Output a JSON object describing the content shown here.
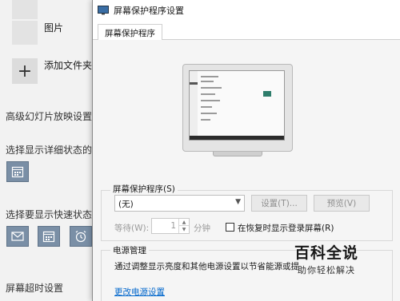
{
  "background": {
    "library_items": [
      {
        "label": "图片"
      },
      {
        "label": "添加文件夹"
      }
    ],
    "advanced_slideshow": "高级幻灯片放映设置",
    "detail_status_heading": "选择显示详细状态的应",
    "quick_status_heading": "选择要显示快速状态的",
    "screen_timeout": "屏幕超时设置",
    "add_icon": "plus-icon"
  },
  "dialog": {
    "title": "屏幕保护程序设置",
    "tab": "屏幕保护程序",
    "saver_group_label": "屏幕保护程序(S)",
    "saver_selected": "(无)",
    "settings_button": "设置(T)...",
    "preview_button": "预览(V)",
    "wait_label": "等待(W):",
    "wait_value": "1",
    "wait_unit": "分钟",
    "resume_checkbox_label": "在恢复时显示登录屏幕(R)",
    "resume_checked": false,
    "power_group_label": "电源管理",
    "power_description": "通过调整显示亮度和其他电源设置以节省能源或提",
    "power_link": "更改电源设置"
  },
  "watermark": {
    "title": "百科全说",
    "subtitle": "助你轻松解决"
  },
  "colors": {
    "link": "#0066cc",
    "icon_button": "#7a8fa6"
  }
}
